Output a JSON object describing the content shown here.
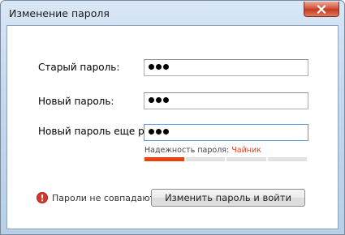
{
  "window": {
    "title": "Изменение пароля"
  },
  "form": {
    "old_password_label": "Старый пароль:",
    "old_password_dots": 3,
    "new_password_label": "Новый пароль:",
    "new_password_dots": 3,
    "repeat_password_label": "Новый пароль еще раз:",
    "repeat_password_dots": 3
  },
  "strength": {
    "label": "Надежность пароля:",
    "value": "Чайник",
    "value_color": "#e0411e",
    "segments_total": 4,
    "segments_filled": 1,
    "fill_color": "#e8440f"
  },
  "error": {
    "icon": "error-icon",
    "message": "Пароли не совпадают"
  },
  "submit": {
    "label": "Изменить пароль и войти"
  }
}
